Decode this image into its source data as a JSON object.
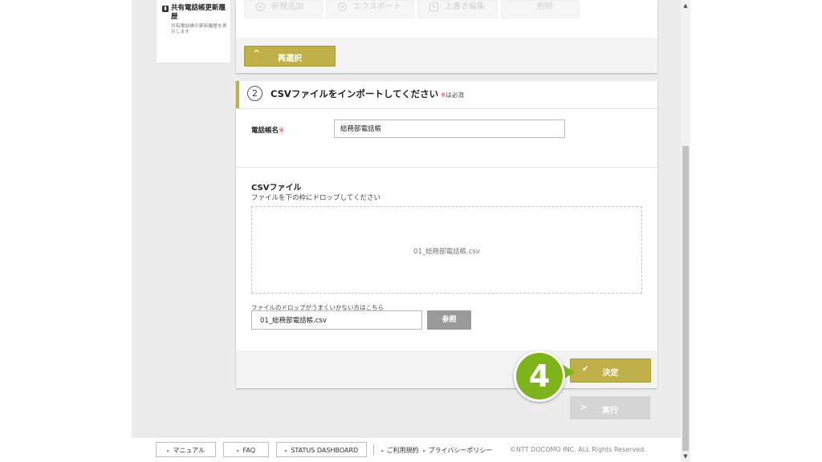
{
  "sidebar": {
    "history_title": "共有電話帳更新履歴",
    "history_desc": "共有電話帳の更新履歴を表示します"
  },
  "toolbar": {
    "add_label": "新規追加",
    "export_label": "エクスポート",
    "edit_label": "上書き編集",
    "delete_label": "削除",
    "reselect_label": "再選択"
  },
  "import_panel": {
    "step_number": "2",
    "title": "CSVファイルをインポートしてください",
    "required_note": "は必須",
    "required_mark": "※",
    "phonebook_name_label": "電話帳名",
    "phonebook_name_value": "総務部電話帳",
    "csv_title": "CSVファイル",
    "csv_instruction": "ファイルを下の枠にドロップしてください",
    "dropped_file": "01_総務部電話帳.csv",
    "fallback_note": "ファイルのドロップがうまくいかない方はこちら",
    "file_field_value": "01_総務部電話帳.csv",
    "browse_label": "参照",
    "decide_label": "決定"
  },
  "callout": {
    "number": "4",
    "color": "#7fb31c"
  },
  "actions": {
    "run_label": "実行"
  },
  "footer": {
    "manual": "マニュアル",
    "faq": "FAQ",
    "status": "STATUS DASHBOARD",
    "terms": "ご利用規約",
    "privacy": "プライバシーポリシー",
    "copyright": "©NTT DOCOMO INC. ALL Rights Reserved."
  },
  "colors": {
    "accent": "#c0b04a",
    "required": "#e03b3b",
    "disabled_button": "#d4d4d4"
  }
}
